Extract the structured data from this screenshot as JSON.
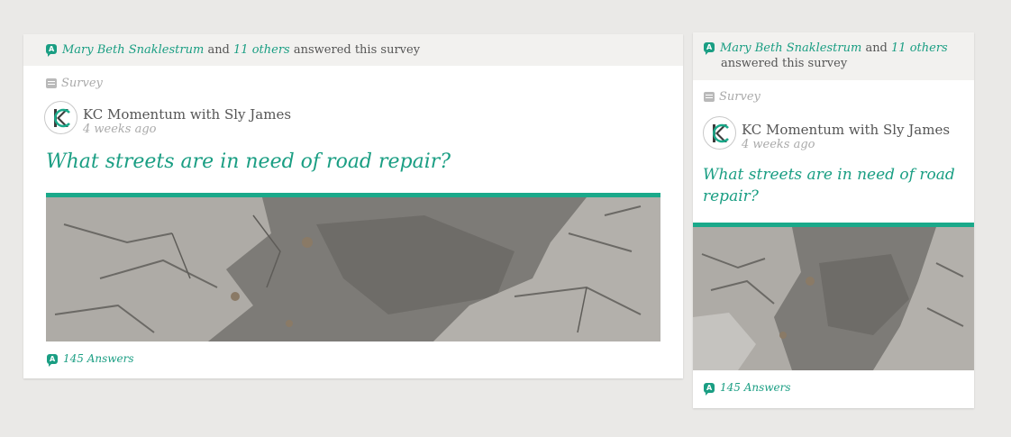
{
  "activity": {
    "user": "Mary Beth Snaklestrum",
    "connector": "and",
    "others": "11 others",
    "suffix": "answered this survey"
  },
  "post": {
    "type_label": "Survey",
    "author": "KC Momentum with Sly James",
    "time": "4 weeks ago",
    "title": "What streets are in need of road repair?",
    "answers": "145 Answers"
  },
  "icons": [
    "answer-bubble-icon",
    "survey-icon",
    "kc-logo-avatar"
  ],
  "colors": {
    "accent": "#1a9e83",
    "background": "#eae9e7",
    "header_bar": "#f2f1ef"
  }
}
